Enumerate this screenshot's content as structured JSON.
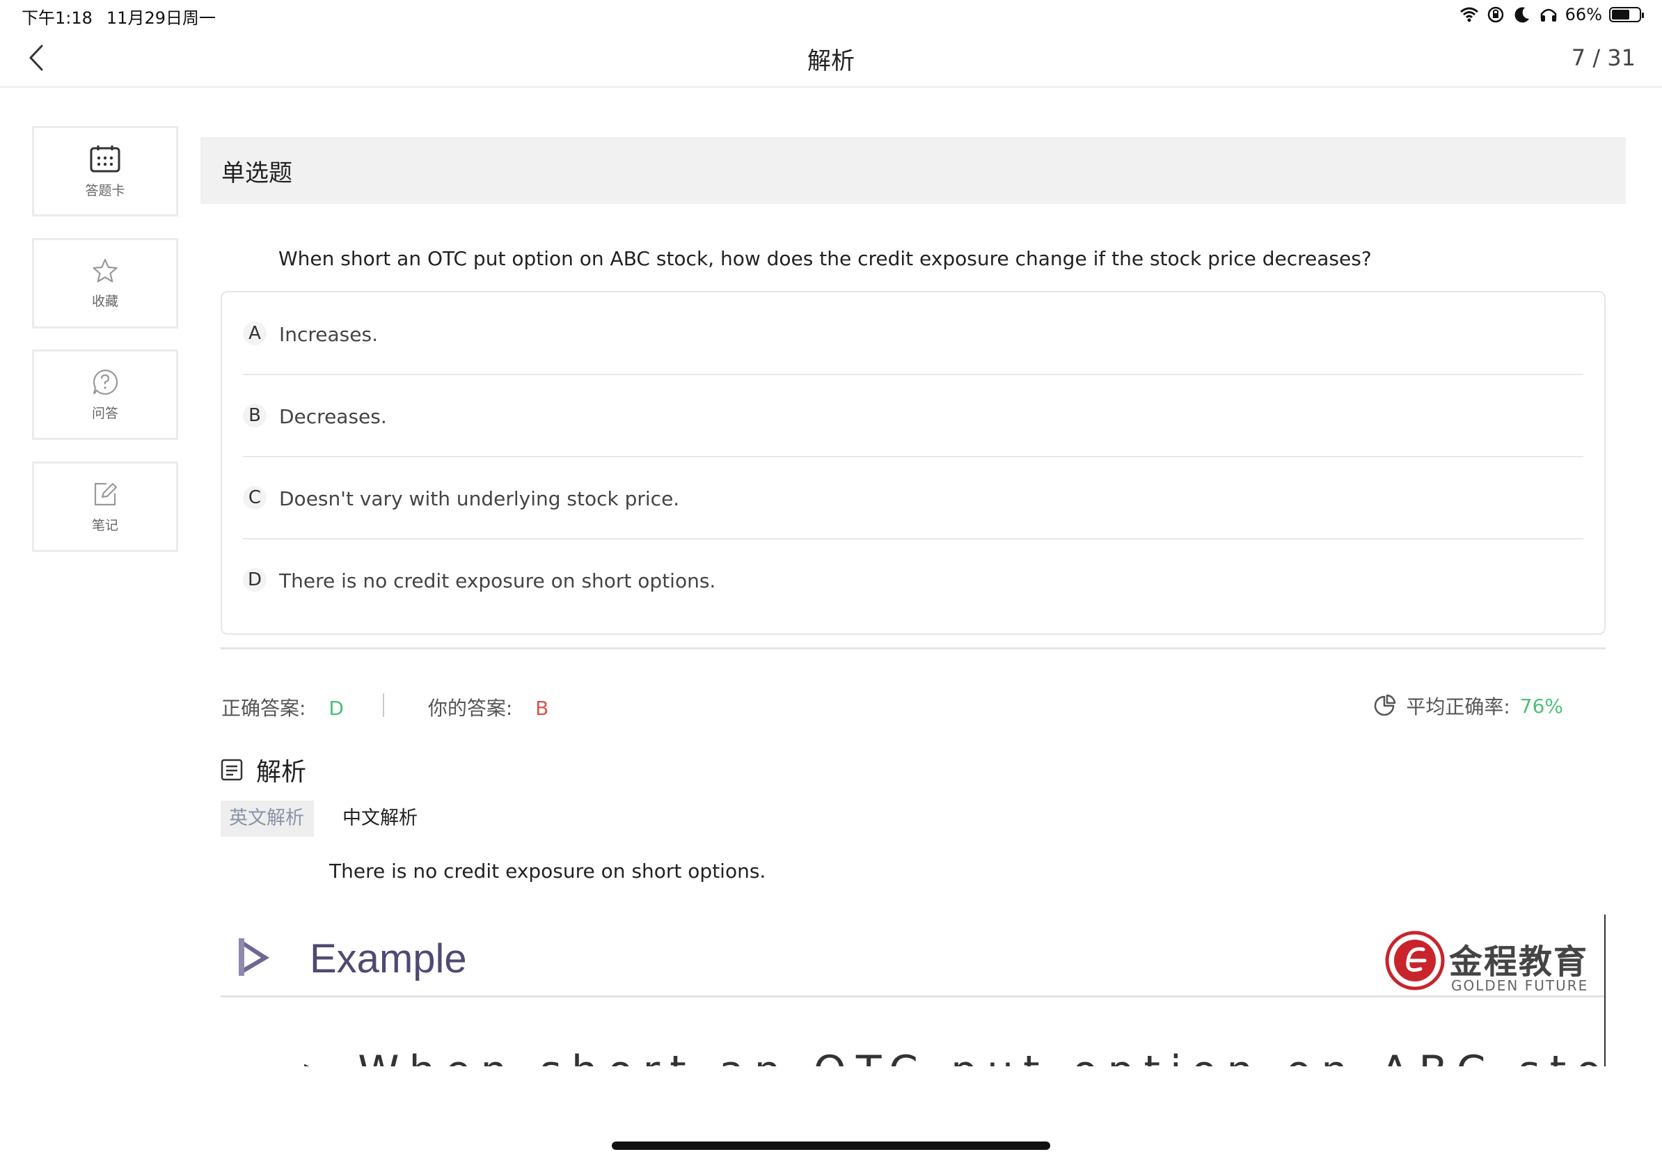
{
  "status_bar": {
    "time": "下午1:18",
    "date": "11月29日周一",
    "battery": "66%",
    "battery_level": 0.66
  },
  "nav": {
    "title": "解析",
    "counter": "7 / 31"
  },
  "sidebar": {
    "items": [
      {
        "label": "答题卡",
        "icon": "answer-card-icon"
      },
      {
        "label": "收藏",
        "icon": "star-icon"
      },
      {
        "label": "问答",
        "icon": "question-bubble-icon"
      },
      {
        "label": "笔记",
        "icon": "edit-note-icon"
      }
    ]
  },
  "question": {
    "type": "单选题",
    "stem": "When short an OTC put option on ABC stock, how does the credit exposure change if the stock price decreases?",
    "options": [
      {
        "letter": "A",
        "text": "Increases."
      },
      {
        "letter": "B",
        "text": "Decreases."
      },
      {
        "letter": "C",
        "text": "Doesn't vary with underlying stock price."
      },
      {
        "letter": "D",
        "text": "There is no credit exposure on short options."
      }
    ]
  },
  "answer": {
    "correct_label": "正确答案:",
    "correct_value": "D",
    "yours_label": "你的答案:",
    "yours_value": "B",
    "rate_label": "平均正确率:",
    "rate_value": "76%",
    "colors": {
      "correct": "#4cbf7a",
      "wrong": "#d9534f"
    }
  },
  "analysis": {
    "heading": "解析",
    "tabs": [
      "英文解析",
      "中文解析"
    ],
    "active_tab": "英文解析",
    "text": "There is no credit exposure on short options."
  },
  "slide": {
    "title": "Example",
    "logo_cn": "金程教育",
    "logo_en": "GOLDEN FUTURE"
  }
}
